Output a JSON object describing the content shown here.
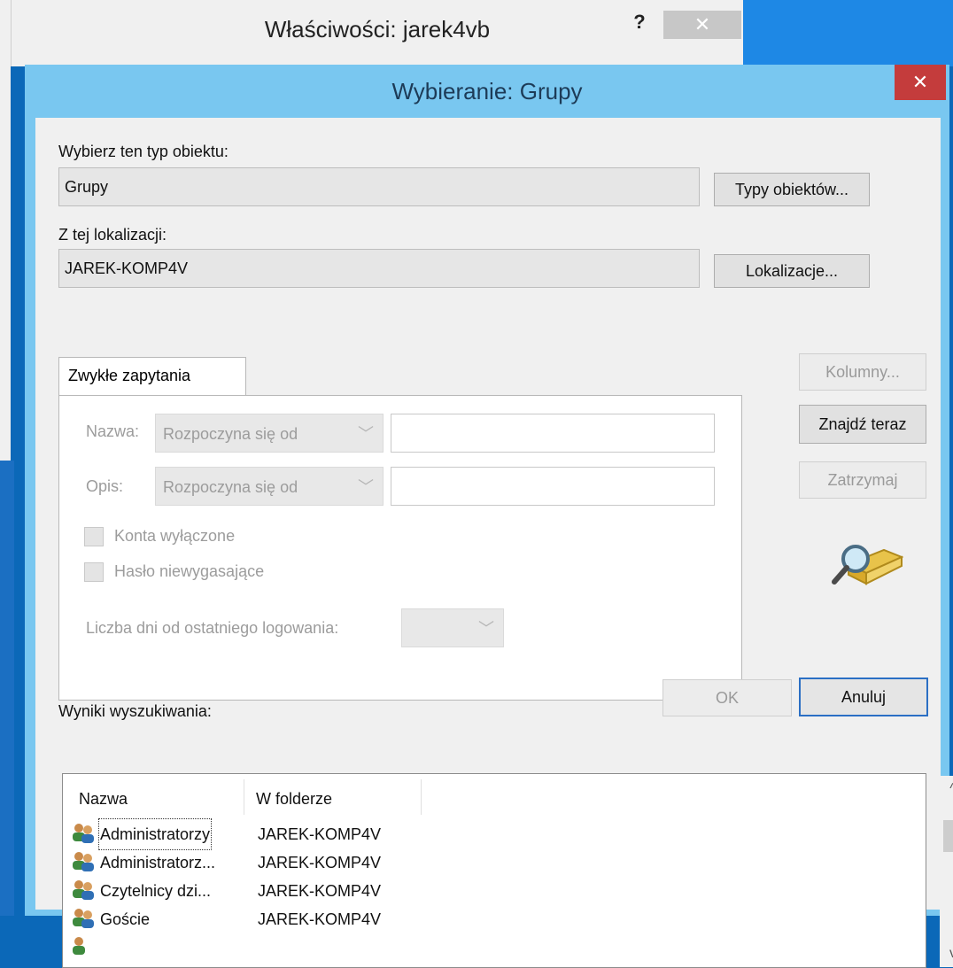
{
  "back_window": {
    "title": "Właściwości: jarek4vb",
    "help_label": "?",
    "close_label": "✕"
  },
  "dialog": {
    "title": "Wybieranie: Grupy",
    "close_label": "✕",
    "object_type_label": "Wybierz ten typ obiektu:",
    "object_type_value": "Grupy",
    "object_types_button": "Typy obiektów...",
    "location_label": "Z tej lokalizacji:",
    "location_value": "JAREK-KOMP4V",
    "locations_button": "Lokalizacje...",
    "tab_label": "Zwykłe zapytania",
    "query": {
      "name_label": "Nazwa:",
      "name_mode": "Rozpoczyna się od",
      "name_value": "",
      "desc_label": "Opis:",
      "desc_mode": "Rozpoczyna się od",
      "desc_value": "",
      "disabled_accounts_label": "Konta wyłączone",
      "non_expiring_label": "Hasło niewygasające",
      "days_label": "Liczba dni od ostatniego logowania:",
      "days_value": ""
    },
    "columns_button": "Kolumny...",
    "find_now_button": "Znajdź teraz",
    "stop_button": "Zatrzymaj",
    "ok_button": "OK",
    "cancel_button": "Anuluj",
    "results_label": "Wyniki wyszukiwania:",
    "results_columns": [
      "Nazwa",
      "W folderze"
    ],
    "results_rows": [
      {
        "name": "Administratorzy",
        "folder": "JAREK-KOMP4V"
      },
      {
        "name": "Administratorz...",
        "folder": "JAREK-KOMP4V"
      },
      {
        "name": "Czytelnicy dzi...",
        "folder": "JAREK-KOMP4V"
      },
      {
        "name": "Goście",
        "folder": "JAREK-KOMP4V"
      }
    ],
    "scroll_up": "^",
    "scroll_down": "v"
  },
  "icons": {
    "search": "magnifier-folder-icon",
    "group": "user-group-icon"
  },
  "colors": {
    "title_bar": "#79c7f0",
    "close_red": "#c43c3c",
    "default_button_border": "#2b6fc4",
    "disabled_text": "#9c9c9c"
  }
}
